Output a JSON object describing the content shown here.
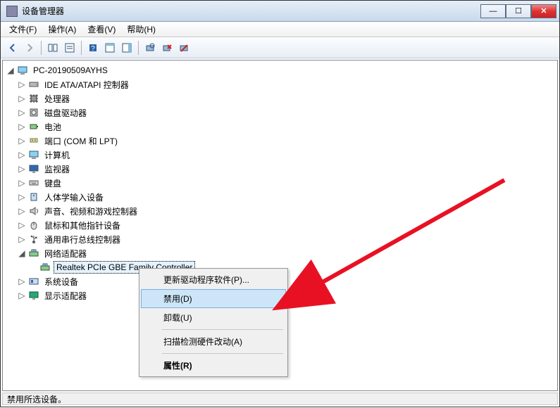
{
  "window": {
    "title": "设备管理器"
  },
  "menubar": [
    "文件(F)",
    "操作(A)",
    "查看(V)",
    "帮助(H)"
  ],
  "tree": {
    "root": "PC-20190509AYHS",
    "nodes": [
      {
        "label": "IDE ATA/ATAPI 控制器",
        "icon": "drive-icon"
      },
      {
        "label": "处理器",
        "icon": "chip-icon"
      },
      {
        "label": "磁盘驱动器",
        "icon": "disk-icon"
      },
      {
        "label": "电池",
        "icon": "battery-icon"
      },
      {
        "label": "端口 (COM 和 LPT)",
        "icon": "port-icon"
      },
      {
        "label": "计算机",
        "icon": "computer-icon"
      },
      {
        "label": "监视器",
        "icon": "monitor-icon"
      },
      {
        "label": "键盘",
        "icon": "keyboard-icon"
      },
      {
        "label": "人体学输入设备",
        "icon": "hid-icon"
      },
      {
        "label": "声音、视频和游戏控制器",
        "icon": "audio-icon"
      },
      {
        "label": "鼠标和其他指针设备",
        "icon": "mouse-icon"
      },
      {
        "label": "通用串行总线控制器",
        "icon": "usb-icon"
      },
      {
        "label": "网络适配器",
        "icon": "network-icon",
        "expanded": true,
        "children": [
          {
            "label": "Realtek PCIe GBE Family Controller",
            "icon": "network-icon",
            "selected": true
          }
        ]
      },
      {
        "label": "系统设备",
        "icon": "system-icon"
      },
      {
        "label": "显示适配器",
        "icon": "display-icon"
      }
    ]
  },
  "contextmenu": {
    "items": [
      {
        "label": "更新驱动程序软件(P)...",
        "key": "update"
      },
      {
        "label": "禁用(D)",
        "key": "disable",
        "highlight": true
      },
      {
        "label": "卸载(U)",
        "key": "uninstall"
      },
      {
        "sep": true
      },
      {
        "label": "扫描检测硬件改动(A)",
        "key": "scan"
      },
      {
        "sep": true
      },
      {
        "label": "属性(R)",
        "key": "properties",
        "bold": true
      }
    ]
  },
  "statusbar": {
    "text": "禁用所选设备。"
  }
}
